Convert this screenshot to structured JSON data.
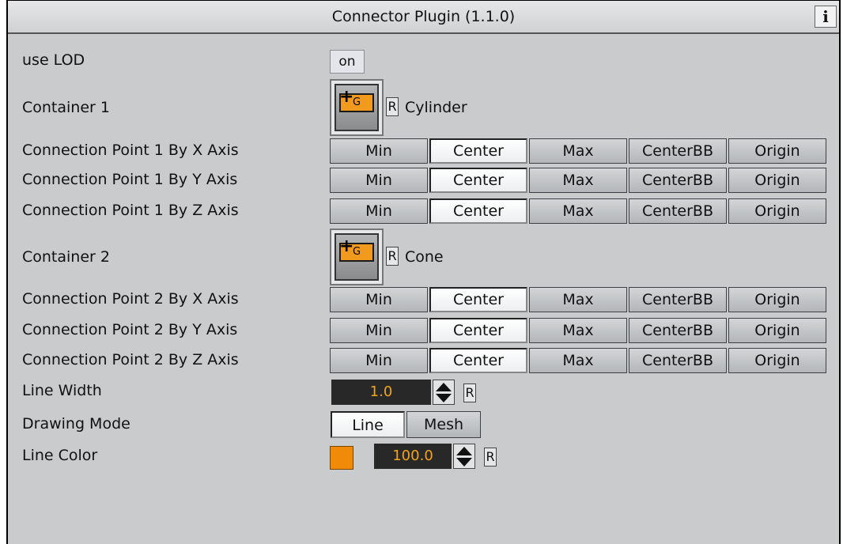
{
  "title": "Connector Plugin (1.1.0)",
  "info_label": "i",
  "use_lod": {
    "label": "use LOD",
    "value": "on"
  },
  "container1": {
    "label": "Container 1",
    "icon_text": "G",
    "icon_plus": "+",
    "reset": "R",
    "name": "Cylinder"
  },
  "container2": {
    "label": "Container 2",
    "icon_text": "G",
    "icon_plus": "+",
    "reset": "R",
    "name": "Cone"
  },
  "axis_options": [
    "Min",
    "Center",
    "Max",
    "CenterBB",
    "Origin"
  ],
  "cp1": [
    {
      "label": "Connection Point 1 By X Axis",
      "selected": "Center"
    },
    {
      "label": "Connection Point 1 By Y Axis",
      "selected": "Center"
    },
    {
      "label": "Connection Point 1 By Z Axis",
      "selected": "Center"
    }
  ],
  "cp2": [
    {
      "label": "Connection Point 2 By X Axis",
      "selected": "Center"
    },
    {
      "label": "Connection Point 2 By Y Axis",
      "selected": "Center"
    },
    {
      "label": "Connection Point 2 By Z Axis",
      "selected": "Center"
    }
  ],
  "line_width": {
    "label": "Line Width",
    "value": "1.0",
    "reset": "R"
  },
  "drawing_mode": {
    "label": "Drawing Mode",
    "options": [
      "Line",
      "Mesh"
    ],
    "selected": "Line"
  },
  "line_color": {
    "label": "Line Color",
    "value": "100.0",
    "reset": "R",
    "color": "#f08a07"
  },
  "colors": {
    "panel_bg": "#c9cbcd",
    "field_bg": "#282828",
    "field_text": "#f2a31b",
    "accent": "#f08a07"
  }
}
